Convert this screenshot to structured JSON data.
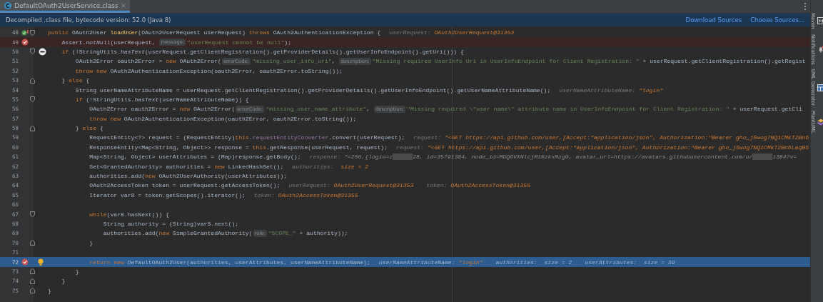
{
  "tab": {
    "title": "DefaultOAuth2UserService.class",
    "selected": true
  },
  "info_bar": {
    "message": "Decompiled .class file, bytecode version: 52.0 (Java 8)",
    "links": [
      "Download Sources",
      "Choose Sources..."
    ]
  },
  "tool_strip": [
    {
      "label": "Maven",
      "kind": "maven"
    },
    {
      "label": "Notifications",
      "kind": "bell"
    },
    {
      "label": "UML Generator",
      "kind": "uml"
    },
    {
      "label": "PlantUML",
      "kind": "plantuml"
    }
  ],
  "lines": [
    {
      "number": "48",
      "kind": "normal",
      "gutter": [
        {
          "kind": "method_breakpoint"
        },
        {
          "kind": "fold_start"
        }
      ],
      "code": [
        {
          "kind": "keyword",
          "text": "public "
        },
        {
          "kind": "code",
          "text": "OAuth2User "
        },
        {
          "kind": "declaration",
          "text": "loadUser"
        },
        {
          "kind": "code",
          "text": "(OAuth2UserRequest userRequest) "
        },
        {
          "kind": "keyword",
          "text": "throws "
        },
        {
          "kind": "code",
          "text": "OAuth2AuthenticationException {"
        },
        {
          "kind": "debug_label",
          "text": "userRequest: "
        },
        {
          "kind": "debug_value",
          "text": "OAuth2UserRequest@31353"
        }
      ]
    },
    {
      "number": "49",
      "kind": "breakpoint_hit",
      "gutter": [
        {
          "kind": "breakpoint"
        }
      ],
      "code": [
        {
          "kind": "code",
          "text": "    Assert."
        },
        {
          "kind": "static",
          "text": "notNull"
        },
        {
          "kind": "code",
          "text": "(userRequest, "
        },
        {
          "kind": "hint",
          "text": "message:"
        },
        {
          "kind": "string",
          "text": "\"userRequest cannot be null\""
        },
        {
          "kind": "code",
          "text": ");"
        }
      ]
    },
    {
      "number": "50",
      "kind": "normal",
      "gutter": [
        {
          "kind": "fold_start"
        },
        {
          "kind": "no_suspend"
        }
      ],
      "code": [
        {
          "kind": "keyword",
          "text": "    if "
        },
        {
          "kind": "code",
          "text": "(!StringUtils."
        },
        {
          "kind": "static",
          "text": "hasText"
        },
        {
          "kind": "code",
          "text": "(userRequest.getClientRegistration().getProviderDetails().getUserInfoEndpoint().getUri())) {"
        }
      ]
    },
    {
      "number": "51",
      "kind": "normal",
      "code": [
        {
          "kind": "code",
          "text": "        OAuth2Error oauth2Error = "
        },
        {
          "kind": "keyword",
          "text": "new "
        },
        {
          "kind": "code",
          "text": "OAuth2Error("
        },
        {
          "kind": "hint",
          "text": "errorCode:"
        },
        {
          "kind": "string",
          "text": "\"missing_user_info_uri\""
        },
        {
          "kind": "code",
          "text": ", "
        },
        {
          "kind": "hint",
          "text": "description:"
        },
        {
          "kind": "string",
          "text": "\"Missing required UserInfo Uri in UserInfoEndpoint for Client Registration: \""
        },
        {
          "kind": "code",
          "text": " + userRequest.getClientRegistration().getRegist"
        }
      ]
    },
    {
      "number": "52",
      "kind": "normal",
      "code": [
        {
          "kind": "keyword",
          "text": "        throw new "
        },
        {
          "kind": "code",
          "text": "OAuth2AuthenticationException(oauth2Error, oauth2Error.toString());"
        }
      ]
    },
    {
      "number": "53",
      "kind": "normal",
      "gutter": [
        {
          "kind": "fold_end"
        }
      ],
      "code": [
        {
          "kind": "code",
          "text": "    } "
        },
        {
          "kind": "keyword",
          "text": "else "
        },
        {
          "kind": "code",
          "text": "{"
        }
      ]
    },
    {
      "number": "54",
      "kind": "normal",
      "code": [
        {
          "kind": "code",
          "text": "        String userNameAttributeName = userRequest.getClientRegistration().getProviderDetails().getUserInfoEndpoint().getUserNameAttributeName();"
        },
        {
          "kind": "debug_label",
          "text": "userNameAttributeName: "
        },
        {
          "kind": "debug_value",
          "text": "\"login\""
        }
      ]
    },
    {
      "number": "55",
      "kind": "normal",
      "gutter": [
        {
          "kind": "fold_start"
        }
      ],
      "code": [
        {
          "kind": "keyword",
          "text": "        if "
        },
        {
          "kind": "code",
          "text": "(!StringUtils."
        },
        {
          "kind": "static",
          "text": "hasText"
        },
        {
          "kind": "code",
          "text": "(userNameAttributeName)) {"
        }
      ]
    },
    {
      "number": "56",
      "kind": "normal",
      "code": [
        {
          "kind": "code",
          "text": "            OAuth2Error oauth2Error = "
        },
        {
          "kind": "keyword",
          "text": "new "
        },
        {
          "kind": "code",
          "text": "OAuth2Error("
        },
        {
          "kind": "hint",
          "text": "errorCode:"
        },
        {
          "kind": "string",
          "text": "\"missing_user_name_attribute\""
        },
        {
          "kind": "code",
          "text": ", "
        },
        {
          "kind": "hint",
          "text": "description:"
        },
        {
          "kind": "string",
          "text": "\"Missing required \\\"user name\\\" attribute name in UserInfoEndpoint for Client Registration: \""
        },
        {
          "kind": "code",
          "text": " + userRequest.getCli"
        }
      ]
    },
    {
      "number": "57",
      "kind": "normal",
      "code": [
        {
          "kind": "keyword",
          "text": "            throw new "
        },
        {
          "kind": "code",
          "text": "OAuth2AuthenticationException(oauth2Error, oauth2Error.toString());"
        }
      ]
    },
    {
      "number": "58",
      "kind": "normal",
      "gutter": [
        {
          "kind": "fold_end"
        }
      ],
      "code": [
        {
          "kind": "code",
          "text": "        } "
        },
        {
          "kind": "keyword",
          "text": "else "
        },
        {
          "kind": "code",
          "text": "{"
        }
      ]
    },
    {
      "number": "59",
      "kind": "normal",
      "code": [
        {
          "kind": "code",
          "text": "            RequestEntity<?> request = (RequestEntity)"
        },
        {
          "kind": "keyword",
          "text": "this"
        },
        {
          "kind": "code",
          "text": "."
        },
        {
          "kind": "field",
          "text": "requestEntityConverter"
        },
        {
          "kind": "code",
          "text": ".convert(userRequest);"
        },
        {
          "kind": "debug_label",
          "text": "request: "
        },
        {
          "kind": "debug_value",
          "text": "\"<GET https://api.github.com/user,[Accept:\"application/json\", Authorization:\"Bearer gho_jSwog7NQ1CMkT2Bn6"
        }
      ]
    },
    {
      "number": "60",
      "kind": "normal",
      "code": [
        {
          "kind": "code",
          "text": "            ResponseEntity<Map<String, Object>> response = "
        },
        {
          "kind": "keyword",
          "text": "this"
        },
        {
          "kind": "code",
          "text": ".getResponse(userRequest, request);"
        },
        {
          "kind": "debug_label",
          "text": "request: "
        },
        {
          "kind": "debug_value",
          "text": "\"<GET https://api.github.com/user,[Accept:\"application/json\", Authorization:\"Bearer gho_jSwog7NQ1CMkT2Bn6LaqBS"
        }
      ]
    },
    {
      "number": "61",
      "kind": "normal",
      "code": [
        {
          "kind": "code",
          "text": "            Map<String, Object> userAttributes = (Map)response.getBody();"
        },
        {
          "kind": "debug_label",
          "text": "response: "
        },
        {
          "kind": "debug_text",
          "text": "\"<200,{login=z"
        },
        {
          "kind": "redacted"
        },
        {
          "kind": "debug_text",
          "text": "28, id=35791384, node_id=MDQ6VXNlcjM1NzkxMzg0, avatar_url=https://avatars.githubusercontent.com/u/"
        },
        {
          "kind": "redacted"
        },
        {
          "kind": "debug_text",
          "text": "1384?v="
        }
      ]
    },
    {
      "number": "62",
      "kind": "normal",
      "code": [
        {
          "kind": "code",
          "text": "            Set<GrantedAuthority> authorities = "
        },
        {
          "kind": "keyword",
          "text": "new "
        },
        {
          "kind": "code",
          "text": "LinkedHashSet();"
        },
        {
          "kind": "debug_label",
          "text": "authorities:  "
        },
        {
          "kind": "debug_value",
          "text": "size = 2"
        }
      ]
    },
    {
      "number": "63",
      "kind": "normal",
      "code": [
        {
          "kind": "code",
          "text": "            authorities.add("
        },
        {
          "kind": "keyword",
          "text": "new "
        },
        {
          "kind": "code",
          "text": "OAuth2UserAuthority(userAttributes));"
        }
      ]
    },
    {
      "number": "64",
      "kind": "normal",
      "code": [
        {
          "kind": "code",
          "text": "            OAuth2AccessToken token = userRequest.getAccessToken();"
        },
        {
          "kind": "debug_label",
          "text": "userRequest: "
        },
        {
          "kind": "debug_value",
          "text": "OAuth2UserRequest@31353"
        },
        {
          "kind": "debug_label",
          "text": "token: "
        },
        {
          "kind": "debug_value",
          "text": "OAuth2AccessToken@31355"
        }
      ]
    },
    {
      "number": "65",
      "kind": "normal",
      "code": [
        {
          "kind": "code",
          "text": "            Iterator var8 = token.getScopes().iterator();"
        },
        {
          "kind": "debug_label",
          "text": "token: "
        },
        {
          "kind": "debug_value",
          "text": "OAuth2AccessToken@31355"
        }
      ]
    },
    {
      "number": "66",
      "kind": "normal"
    },
    {
      "number": "67",
      "kind": "normal",
      "gutter": [
        {
          "kind": "fold_start"
        }
      ],
      "code": [
        {
          "kind": "keyword",
          "text": "            while"
        },
        {
          "kind": "code",
          "text": "(var8.hasNext()) {"
        }
      ]
    },
    {
      "number": "68",
      "kind": "normal",
      "code": [
        {
          "kind": "code",
          "text": "                String authority = (String)var8.next();"
        }
      ]
    },
    {
      "number": "69",
      "kind": "normal",
      "code": [
        {
          "kind": "code",
          "text": "                authorities.add("
        },
        {
          "kind": "keyword",
          "text": "new "
        },
        {
          "kind": "code",
          "text": "SimpleGrantedAuthority("
        },
        {
          "kind": "hint",
          "text": "role:"
        },
        {
          "kind": "string",
          "text": "\"SCOPE_\""
        },
        {
          "kind": "code",
          "text": " + authority));"
        }
      ]
    },
    {
      "number": "70",
      "kind": "normal",
      "gutter": [
        {
          "kind": "fold_end"
        }
      ],
      "code": [
        {
          "kind": "code",
          "text": "            }"
        }
      ]
    },
    {
      "number": "71",
      "kind": "normal"
    },
    {
      "number": "72",
      "kind": "execution_point",
      "gutter": [
        {
          "kind": "breakpoint"
        },
        {
          "kind": "bulb"
        }
      ],
      "code": [
        {
          "kind": "keyword",
          "text": "            return new "
        },
        {
          "kind": "code",
          "text": "DefaultOAuth2User(authorities, userAttributes, userNameAttributeName);"
        },
        {
          "kind": "debug_label",
          "text": "userNameAttributeName: "
        },
        {
          "kind": "debug_value",
          "text": "\"login\""
        },
        {
          "kind": "debug_label",
          "text": "authorities:  "
        },
        {
          "kind": "debug_text",
          "text": "size = 2"
        },
        {
          "kind": "debug_label",
          "text": "userAttributes:  "
        },
        {
          "kind": "debug_text",
          "text": "size = 39"
        }
      ]
    },
    {
      "number": "73",
      "kind": "normal",
      "gutter": [
        {
          "kind": "fold_end"
        }
      ],
      "code": [
        {
          "kind": "code",
          "text": "        }"
        }
      ]
    },
    {
      "number": "74",
      "kind": "normal",
      "gutter": [
        {
          "kind": "fold_end"
        }
      ],
      "code": [
        {
          "kind": "code",
          "text": "    }"
        }
      ]
    },
    {
      "number": "75",
      "kind": "normal",
      "gutter": [
        {
          "kind": "fold_end"
        }
      ],
      "code": [
        {
          "kind": "code",
          "text": "}"
        }
      ]
    }
  ]
}
